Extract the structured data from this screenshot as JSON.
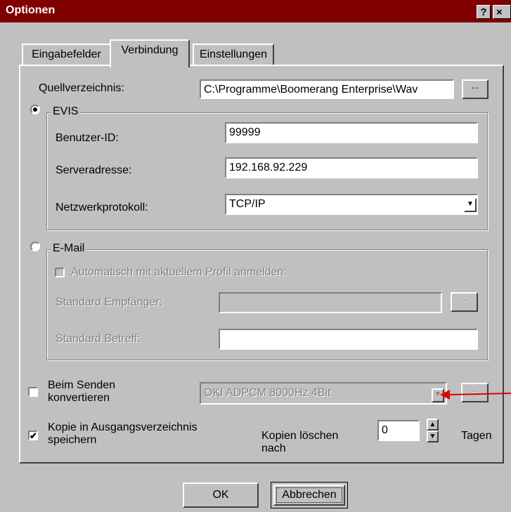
{
  "window": {
    "title": "Optionen",
    "help_label": "?",
    "close_label": "×"
  },
  "tabs": [
    {
      "label": "Eingabefelder"
    },
    {
      "label": "Verbindung"
    },
    {
      "label": "Einstellungen"
    }
  ],
  "source": {
    "label": "Quellverzeichnis:",
    "value": "C:\\Programme\\Boomerang Enterprise\\Wav",
    "browse_label": "..."
  },
  "evis": {
    "legend": "EVIS",
    "selected": true,
    "user_id_label": "Benutzer-ID:",
    "user_id_value": "99999",
    "server_label": "Serveradresse:",
    "server_value": "192.168.92.229",
    "protocol_label": "Netzwerkprotokoll:",
    "protocol_value": "TCP/IP"
  },
  "email": {
    "legend": "E-Mail",
    "selected": false,
    "auto_login_label": "Automatisch mit aktuellem Profil anmelden:",
    "recipient_label": "Standard Empfänger:",
    "recipient_value": "",
    "browse_label": "...",
    "subject_label": "Standard Betreff:",
    "subject_value": ""
  },
  "convert": {
    "label_line1": "Beim Senden",
    "label_line2": "konvertieren",
    "checked": false,
    "format_value": "OKI ADPCM 8000Hz 4Bit",
    "browse_label": "..."
  },
  "copy": {
    "label_line1": "Kopie in Ausgangsverzeichnis",
    "label_line2": "speichern",
    "checked": true,
    "check_mark": "✔",
    "delete_label_line1": "Kopien löschen",
    "delete_label_line2": "nach",
    "days_value": "0",
    "days_unit": "Tagen"
  },
  "buttons": {
    "ok": "OK",
    "cancel": "Abbrechen"
  },
  "colors": {
    "titlebar": "#800000",
    "dialog": "#c0c0c0",
    "annotation_arrow": "#e00000"
  }
}
